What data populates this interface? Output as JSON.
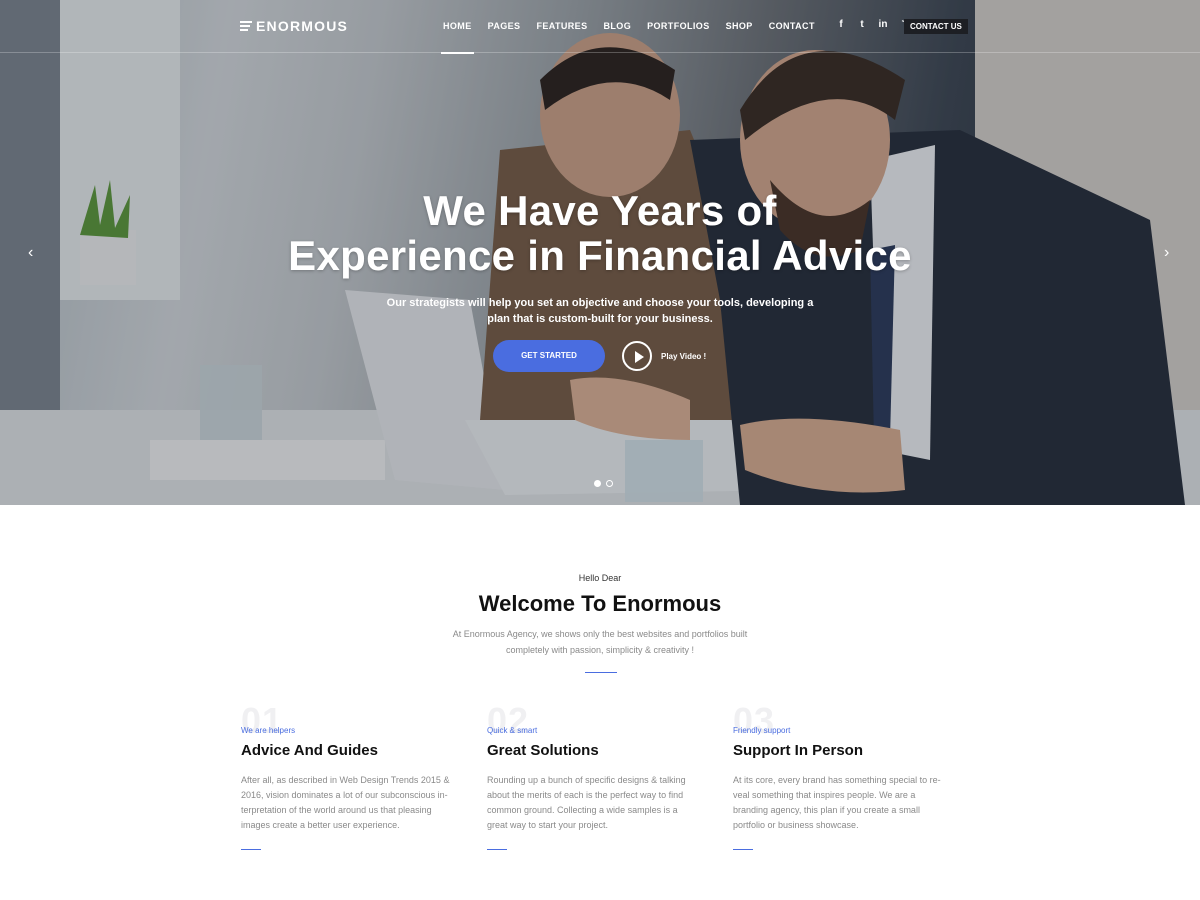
{
  "brand": {
    "name": "ENORMOUS"
  },
  "nav": {
    "items": [
      "HOME",
      "PAGES",
      "FEATURES",
      "BLOG",
      "PORTFOLIOS",
      "SHOP",
      "CONTACT"
    ],
    "socials": [
      "facebook-icon",
      "twitter-icon",
      "linkedin-icon",
      "rss-icon"
    ],
    "social_glyphs": [
      "f",
      "t",
      "in",
      "◝"
    ],
    "contact_button": "CONTACT US"
  },
  "hero": {
    "title_line1": "We Have Years of",
    "title_line2": "Experience in Financial Advice",
    "subtitle_line1": "Our strategists will help you set an objective and choose your tools, developing a",
    "subtitle_line2": "plan that is custom-built for your business.",
    "cta_label": "GET STARTED",
    "play_label": "Play Video !",
    "prev_glyph": "‹",
    "next_glyph": "›",
    "slides": 2,
    "active_slide": 1
  },
  "welcome": {
    "hello": "Hello Dear",
    "title": "Welcome To Enormous",
    "desc_line1": "At Enormous Agency, we shows only the best websites and portfolios built",
    "desc_line2": "completely with passion, simplicity & creativity !"
  },
  "features": [
    {
      "num": "01",
      "tag": "We are helpers",
      "title": "Advice And Guides",
      "lines": [
        "After all, as described in Web Design Trends 2015 &",
        "2016, vision dominates a lot of our subconscious in-",
        "terpretation of the world around us that pleasing",
        "images create a better user experience."
      ]
    },
    {
      "num": "02",
      "tag": "Quick & smart",
      "title": "Great Solutions",
      "lines": [
        "Rounding up a bunch of specific designs & talking",
        "about the merits of each is the perfect way to find",
        "common ground. Collecting a wide samples is a",
        "great way to start your project."
      ]
    },
    {
      "num": "03",
      "tag": "Friendly support",
      "title": "Support In Person",
      "lines": [
        "At its core, every brand has something special to re-",
        "veal something that inspires people. We are a",
        "branding agency, this plan if you create a small",
        "portfolio or business showcase."
      ]
    }
  ],
  "colors": {
    "accent": "#4a6de0",
    "dark_button": "#1d1f24"
  }
}
